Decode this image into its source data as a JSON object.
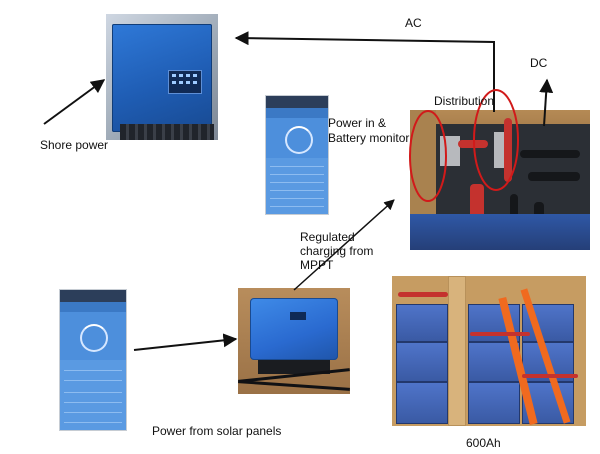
{
  "labels": {
    "ac": "AC",
    "dc": "DC",
    "distribution": "Distribution",
    "shore_power": "Shore power",
    "power_in_line1": "Power in &",
    "power_in_line2": "Battery monitor",
    "regulated_line1": "Regulated",
    "regulated_line2": "charging from",
    "regulated_line3": "MPPT",
    "power_from_solar": "Power from solar panels",
    "capacity": "600Ah"
  },
  "colors": {
    "arrow": "#111111",
    "highlight_circle": "#d11a1a",
    "victron_blue": "#2a6ad0"
  }
}
